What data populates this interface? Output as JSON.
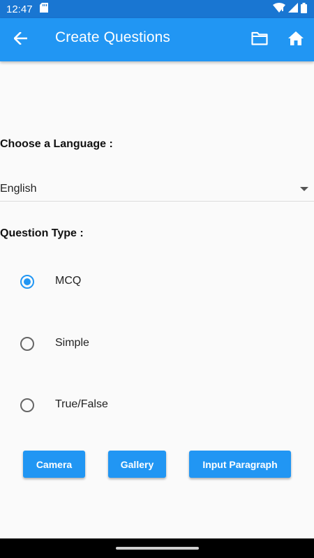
{
  "status_bar": {
    "time": "12:47",
    "icons": [
      "sd-card-icon",
      "wifi-icon",
      "signal-icon",
      "battery-icon"
    ]
  },
  "app_bar": {
    "title": "Create Questions",
    "back_icon": "arrow-back-icon",
    "actions": [
      "folder-icon",
      "home-icon"
    ],
    "color": "#2196f3"
  },
  "language": {
    "label": "Choose a Language :",
    "selected": "English"
  },
  "question_type": {
    "label": "Question Type :",
    "options": [
      {
        "label": "MCQ",
        "selected": true
      },
      {
        "label": "Simple",
        "selected": false
      },
      {
        "label": "True/False",
        "selected": false
      }
    ]
  },
  "buttons": {
    "camera": "Camera",
    "gallery": "Gallery",
    "input_paragraph": "Input Paragraph"
  },
  "colors": {
    "accent": "#2196f3",
    "status_bar": "#1976d2",
    "background": "#fafafa"
  }
}
